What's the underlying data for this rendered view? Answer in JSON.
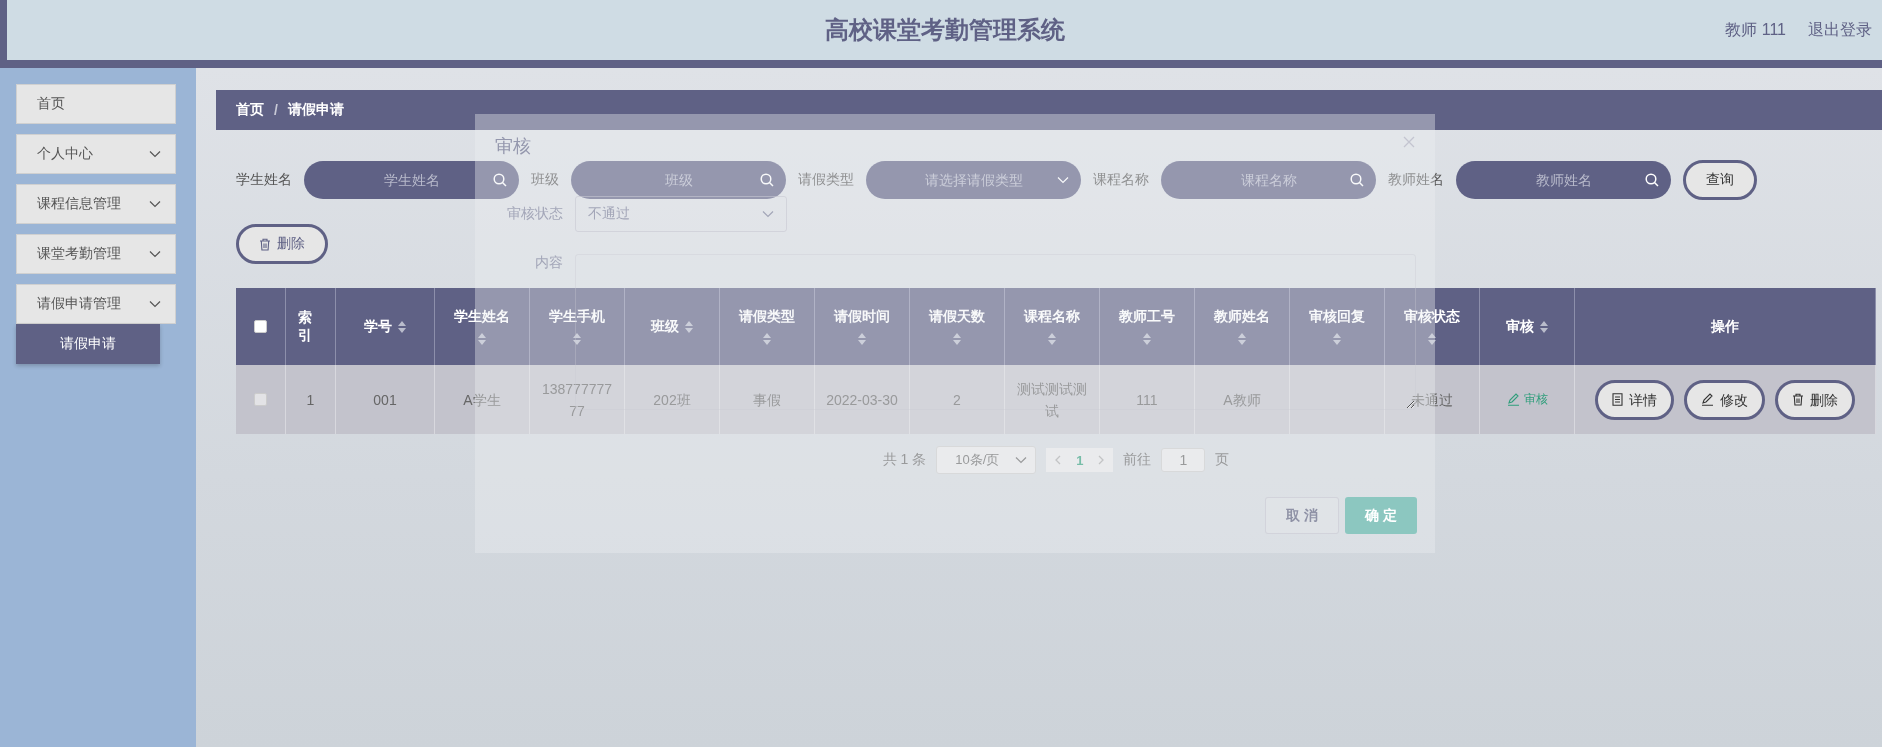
{
  "header": {
    "title": "高校课堂考勤管理系统",
    "user": "教师 111",
    "logout": "退出登录"
  },
  "sidebar": {
    "items": [
      {
        "label": "首页",
        "kind": "link"
      },
      {
        "label": "个人中心",
        "kind": "menu"
      },
      {
        "label": "课程信息管理",
        "kind": "menu"
      },
      {
        "label": "课堂考勤管理",
        "kind": "menu"
      },
      {
        "label": "请假申请管理",
        "kind": "menu",
        "children": [
          {
            "label": "请假申请",
            "selected": true
          }
        ]
      }
    ]
  },
  "breadcrumb": {
    "items": [
      "首页",
      "请假申请"
    ],
    "separator": "/"
  },
  "search": {
    "fields": [
      {
        "label": "学生姓名",
        "placeholder": "学生姓名",
        "kind": "text"
      },
      {
        "label": "班级",
        "placeholder": "班级",
        "kind": "text"
      },
      {
        "label": "请假类型",
        "placeholder": "请选择请假类型",
        "kind": "select"
      },
      {
        "label": "课程名称",
        "placeholder": "课程名称",
        "kind": "text"
      },
      {
        "label": "教师姓名",
        "placeholder": "教师姓名",
        "kind": "text"
      }
    ],
    "button": "查询"
  },
  "toolbar": {
    "delete_button": "删除"
  },
  "table": {
    "all_checked": false,
    "columns": [
      {
        "label": "索引",
        "sortable": false
      },
      {
        "label": "学号",
        "sortable": true
      },
      {
        "label": "学生姓名",
        "sortable": true
      },
      {
        "label": "学生手机",
        "sortable": true
      },
      {
        "label": "班级",
        "sortable": true
      },
      {
        "label": "请假类型",
        "sortable": true
      },
      {
        "label": "请假时间",
        "sortable": true
      },
      {
        "label": "请假天数",
        "sortable": true
      },
      {
        "label": "课程名称",
        "sortable": true
      },
      {
        "label": "教师工号",
        "sortable": true
      },
      {
        "label": "教师姓名",
        "sortable": true
      },
      {
        "label": "审核回复",
        "sortable": true
      },
      {
        "label": "审核状态",
        "sortable": true
      },
      {
        "label": "审核",
        "sortable": true
      },
      {
        "label": "操作",
        "sortable": false
      }
    ],
    "rows": [
      {
        "checked": false,
        "cells": [
          "1",
          "001",
          "A学生",
          "13877777777",
          "202班",
          "事假",
          "2022-03-30",
          "2",
          "测试测试测试",
          "111",
          "A教师",
          null,
          "未通过"
        ],
        "review_link": "审核",
        "actions": [
          {
            "kind": "detail",
            "label": "详情"
          },
          {
            "kind": "edit",
            "label": "修改"
          },
          {
            "kind": "delete",
            "label": "删除"
          }
        ]
      }
    ]
  },
  "pagination": {
    "total": "共 1 条",
    "page_size": "10条/页",
    "pages": [
      {
        "label": "1",
        "selected": true
      }
    ],
    "goto_label": "前往",
    "goto_value": "1",
    "goto_suffix": "页"
  },
  "dialog": {
    "title": "审核",
    "fields": [
      {
        "label": "审核状态",
        "kind": "select",
        "value": "不通过"
      },
      {
        "label": "内容",
        "kind": "textarea"
      }
    ],
    "buttons": [
      {
        "label": "取 消",
        "kind": "cancel"
      },
      {
        "label": "确 定",
        "kind": "confirm"
      }
    ]
  }
}
